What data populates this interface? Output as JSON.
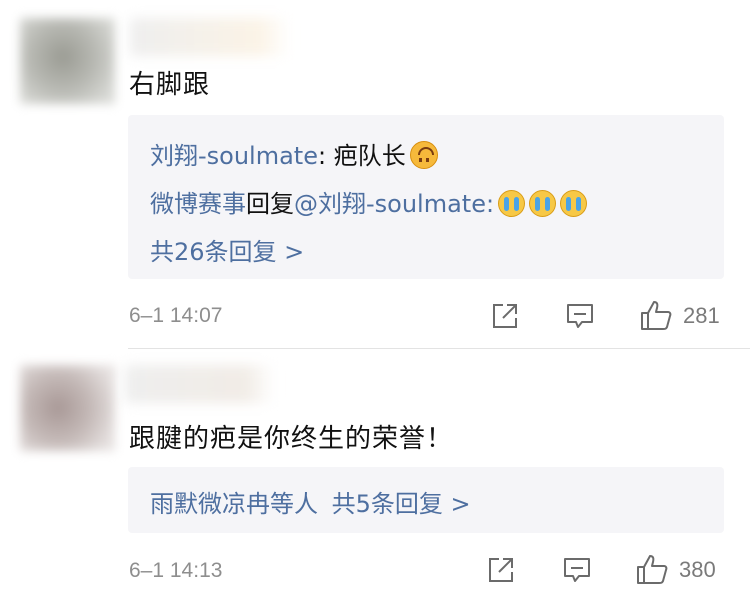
{
  "comments": [
    {
      "text": "右脚跟",
      "reply_box": {
        "line1_author": "刘翔-soulmate",
        "line1_text": ": 疤队长",
        "line1_emoji": "upside-down-face-emoji",
        "line2_author": "微博赛事",
        "line2_mid": "回复",
        "line2_mention": "@刘翔-soulmate",
        "line2_colon": ":",
        "line2_emoji": "loudly-crying-face-emoji",
        "more": "共26条回复 >"
      },
      "time": "6–1 14:07",
      "likes": "281"
    },
    {
      "text": "跟腱的疤是你终生的荣誉！",
      "reply_box": {
        "users": "雨默微凉冉等人",
        "more": "共5条回复 >"
      },
      "time": "6–1 14:13",
      "likes": "380"
    }
  ],
  "icons": {
    "share": "share-icon",
    "comment": "comment-icon",
    "like": "thumbs-up-icon"
  },
  "colors": {
    "link": "#4e6fa0",
    "reply_bg": "#f5f5f8",
    "meta": "#8e8e8e"
  }
}
